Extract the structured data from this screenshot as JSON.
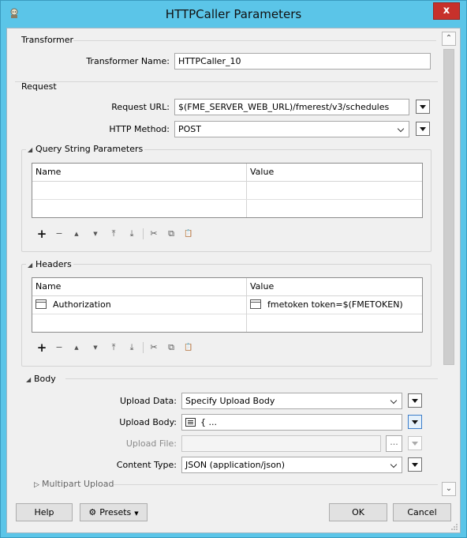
{
  "window": {
    "title": "HTTPCaller Parameters",
    "close_label": "x"
  },
  "transformer": {
    "section_title": "Transformer",
    "name_label": "Transformer Name:",
    "name_value": "HTTPCaller_10"
  },
  "request": {
    "section_title": "Request",
    "url_label": "Request URL:",
    "url_value": "$(FME_SERVER_WEB_URL)/fmerest/v3/schedules",
    "method_label": "HTTP Method:",
    "method_value": "POST"
  },
  "query_params": {
    "title": "Query String Parameters",
    "col_name": "Name",
    "col_value": "Value"
  },
  "headers": {
    "title": "Headers",
    "col_name": "Name",
    "col_value": "Value",
    "rows": [
      {
        "name": "Authorization",
        "value": "fmetoken token=$(FMETOKEN)"
      }
    ]
  },
  "body": {
    "title": "Body",
    "upload_data_label": "Upload Data:",
    "upload_data_value": "Specify Upload Body",
    "upload_body_label": "Upload Body:",
    "upload_body_value": "{ ...",
    "upload_file_label": "Upload File:",
    "upload_file_value": "",
    "content_type_label": "Content Type:",
    "content_type_value": "JSON (application/json)",
    "ellipsis_label": "..."
  },
  "multipart": {
    "title": "Multipart Upload"
  },
  "toolbar_glyphs": {
    "add": "+",
    "remove": "−",
    "up": "▲",
    "down": "▼",
    "top": "⤒",
    "bottom": "⤓",
    "cut": "✂",
    "copy": "⧉",
    "paste": "📋"
  },
  "footer": {
    "help_label": "Help",
    "presets_label": "Presets",
    "ok_label": "OK",
    "cancel_label": "Cancel"
  },
  "colors": {
    "titlebar": "#5bc5e8",
    "close": "#c7312b",
    "dialog_bg": "#f0f0f0"
  }
}
